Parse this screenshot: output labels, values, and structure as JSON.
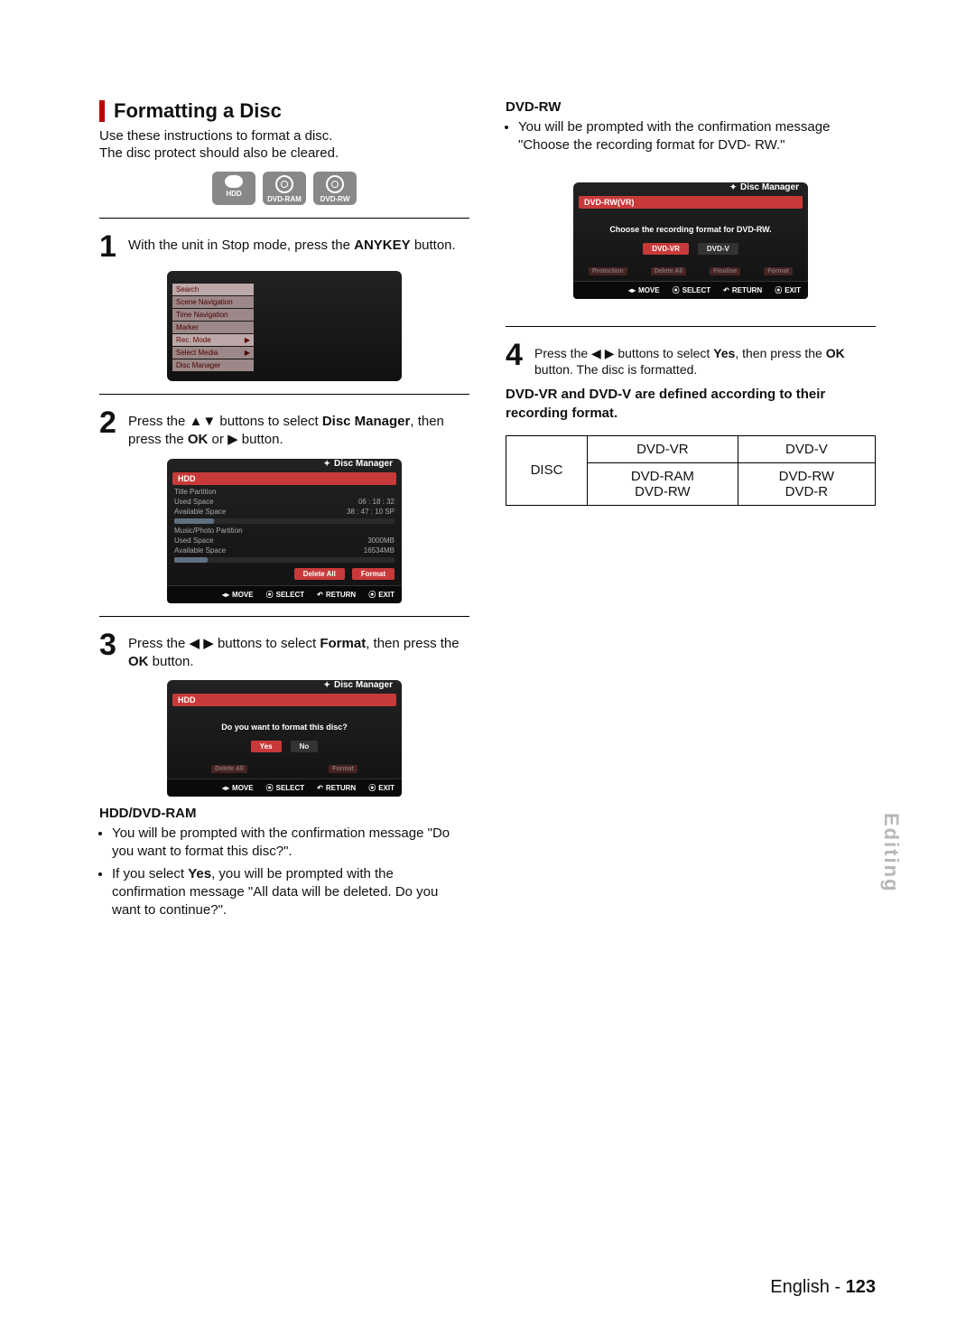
{
  "section": {
    "title": "Formatting a Disc",
    "intro_line1": "Use these instructions to format a disc.",
    "intro_line2": "The disc protect should also be cleared."
  },
  "disc_chips": {
    "hdd": "HDD",
    "ram": "DVD-RAM",
    "rw": "DVD-RW"
  },
  "step1": {
    "num": "1",
    "text_a": "With the unit in Stop mode, press the ",
    "key": "ANYKEY",
    "text_b": " button."
  },
  "osd1_menu": {
    "items": [
      "Search",
      "Scene Navigation",
      "Time Navigation",
      "Marker",
      "Rec. Mode",
      "Select Media",
      "Disc Manager"
    ]
  },
  "step2": {
    "num": "2",
    "text_a": "Press the ",
    "arrows": "▲▼",
    "text_b": " buttons to select ",
    "target": "Disc Manager",
    "text_c": ", then press the ",
    "ok": "OK",
    "text_d": " or ",
    "arrow_r": "▶",
    "text_e": " button."
  },
  "osd2": {
    "title": "Disc Manager",
    "hdd": "HDD",
    "tp": "Title Partition",
    "used": "Used Space",
    "used_v": "06 : 18 : 32",
    "avail": "Available Space",
    "avail_v": "38 : 47 : 10 SP",
    "mp": "Music/Photo Partition",
    "used2": "Used Space",
    "used2_v": "3000MB",
    "avail2": "Available Space",
    "avail2_v": "16534MB",
    "delete": "Delete All",
    "format": "Format"
  },
  "keys": {
    "move": "MOVE",
    "select": "SELECT",
    "return": "RETURN",
    "exit": "EXIT"
  },
  "step3": {
    "num": "3",
    "text_a": "Press the ",
    "arrows": "◀ ▶",
    "text_b": " buttons to select ",
    "target": "Format",
    "text_c": ", then press the ",
    "ok": "OK",
    "text_d": " button."
  },
  "osd3": {
    "title": "Disc Manager",
    "hdd": "HDD",
    "msg": "Do you want to format this disc?",
    "yes": "Yes",
    "no": "No",
    "ghost_delete": "Delete All",
    "ghost_format": "Format"
  },
  "hdd_ram": {
    "heading": "HDD/DVD-RAM",
    "b1": "You will be prompted with the confirmation message \"Do you want to format this disc?\".",
    "b2a": "If you select ",
    "b2_yes": "Yes",
    "b2b": ", you will be prompted with the confirmation message \"All data will be deleted. Do you want to continue?\"."
  },
  "dvd_rw": {
    "heading": "DVD-RW",
    "b1": "You will be prompted with the confirmation message \"Choose the recording format for DVD- RW.\""
  },
  "osd4": {
    "title": "Disc Manager",
    "tab": "DVD-RW(VR)",
    "msg": "Choose the recording format for DVD-RW.",
    "vr": "DVD-VR",
    "v": "DVD-V",
    "ghost": [
      "Protection",
      "Delete All",
      "Finalise",
      "Format"
    ]
  },
  "step4": {
    "num": "4",
    "text_a": "Press the ",
    "arrows": "◀ ▶",
    "text_b": " buttons to select ",
    "yes": "Yes",
    "text_c": ", then press the ",
    "ok": "OK",
    "text_d": " button. The disc is formatted."
  },
  "note": "DVD-VR and DVD-V are defined according to their recording format.",
  "table": {
    "row_label": "DISC",
    "h1": "DVD-VR",
    "h2": "DVD-V",
    "c1a": "DVD-RAM",
    "c1b": "DVD-RW",
    "c2a": "DVD-RW",
    "c2b": "DVD-R"
  },
  "side_tab": "Editing",
  "footer": {
    "lang": "English - ",
    "page": "123"
  }
}
